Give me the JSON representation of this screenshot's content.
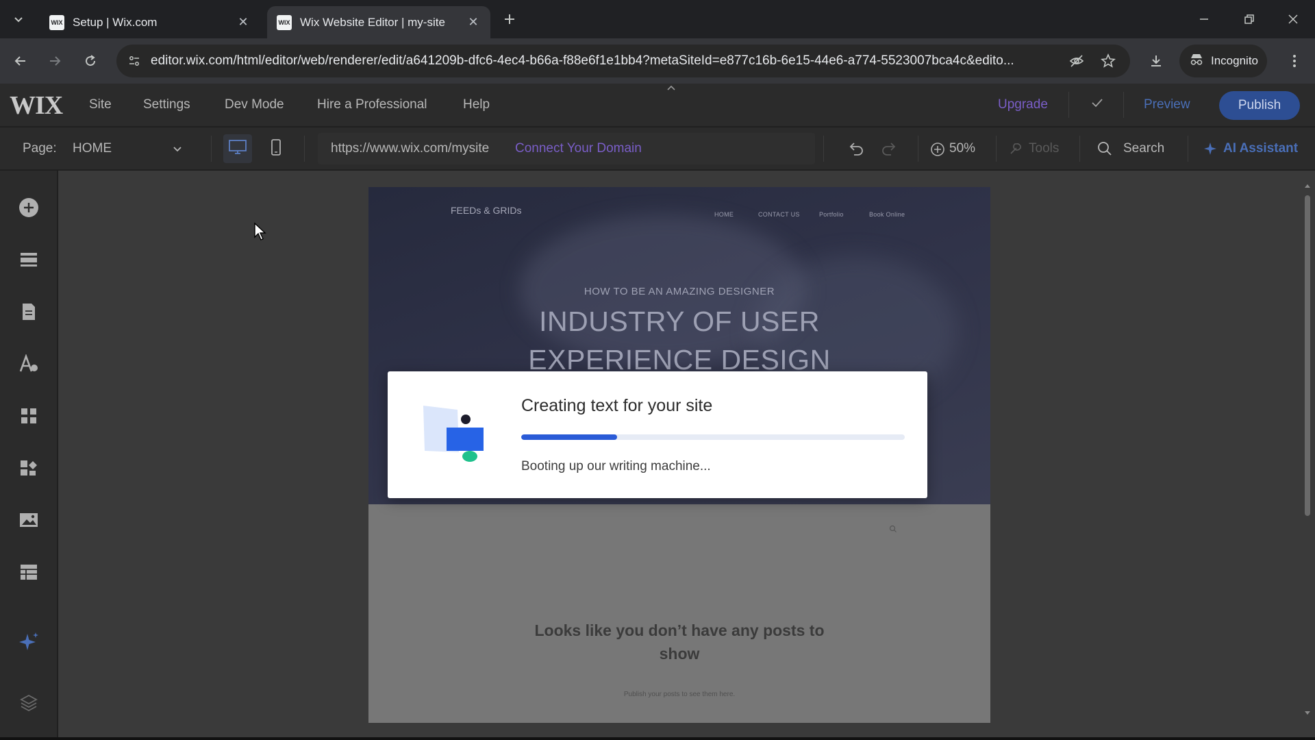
{
  "browser": {
    "tabs": [
      {
        "favicon": "WIX",
        "title": "Setup | Wix.com",
        "active": false
      },
      {
        "favicon": "WIX",
        "title": "Wix Website Editor | my-site",
        "active": true
      }
    ],
    "url": "editor.wix.com/html/editor/web/renderer/edit/a641209b-dfc6-4ec4-b66a-f88e6f1e1bb4?metaSiteId=e877c16b-6e15-44e6-a774-5523007bca4c&edito...",
    "incognito_label": "Incognito"
  },
  "wix": {
    "logo": "WIX",
    "menu": [
      "Site",
      "Settings",
      "Dev Mode",
      "Hire a Professional",
      "Help"
    ],
    "upgrade": "Upgrade",
    "preview": "Preview",
    "publish": "Publish",
    "page_label": "Page:",
    "page_name": "HOME",
    "site_url": "https://www.wix.com/mysite",
    "connect_domain": "Connect Your Domain",
    "zoom": "50%",
    "tools": "Tools",
    "search": "Search",
    "ai_assistant": "AI Assistant"
  },
  "site": {
    "brand": "FEEDs & GRIDs",
    "nav": [
      "HOME",
      "CONTACT US",
      "Portfolio",
      "Book Online"
    ],
    "hero_kicker": "HOW TO BE AN AMAZING DESIGNER",
    "hero_title_line1": "INDUSTRY OF USER",
    "hero_title_line2": "EXPERIENCE DESIGN",
    "empty_title": "Looks like you don’t have any posts to show",
    "empty_sub": "Publish your posts to see them here."
  },
  "modal": {
    "title": "Creating text for your site",
    "subtitle": "Booting up our writing machine...",
    "progress": 0.25
  },
  "colors": {
    "accent": "#2a5bd7",
    "publish_bg": "#2d4e93",
    "link": "#7a5ec8"
  }
}
